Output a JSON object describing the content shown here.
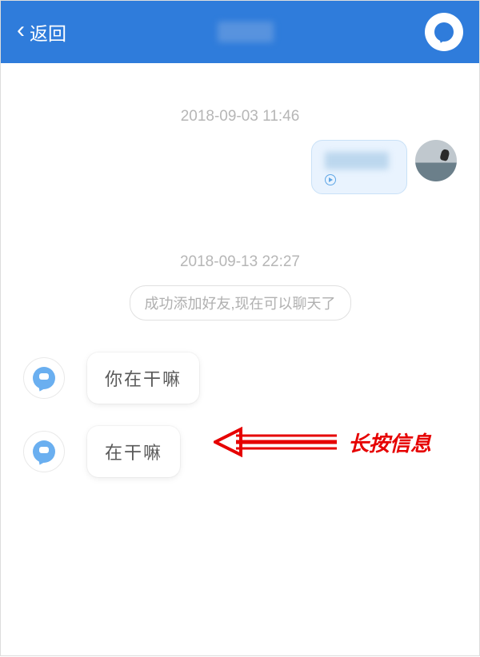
{
  "header": {
    "back_label": "返回"
  },
  "timestamps": {
    "t1": "2018-09-03 11:46",
    "t2": "2018-09-13 22:27"
  },
  "system_message": "成功添加好友,现在可以聊天了",
  "messages": {
    "in1": "你在干嘛",
    "in2": "在干嘛"
  },
  "annotation": {
    "label": "长按信息"
  }
}
